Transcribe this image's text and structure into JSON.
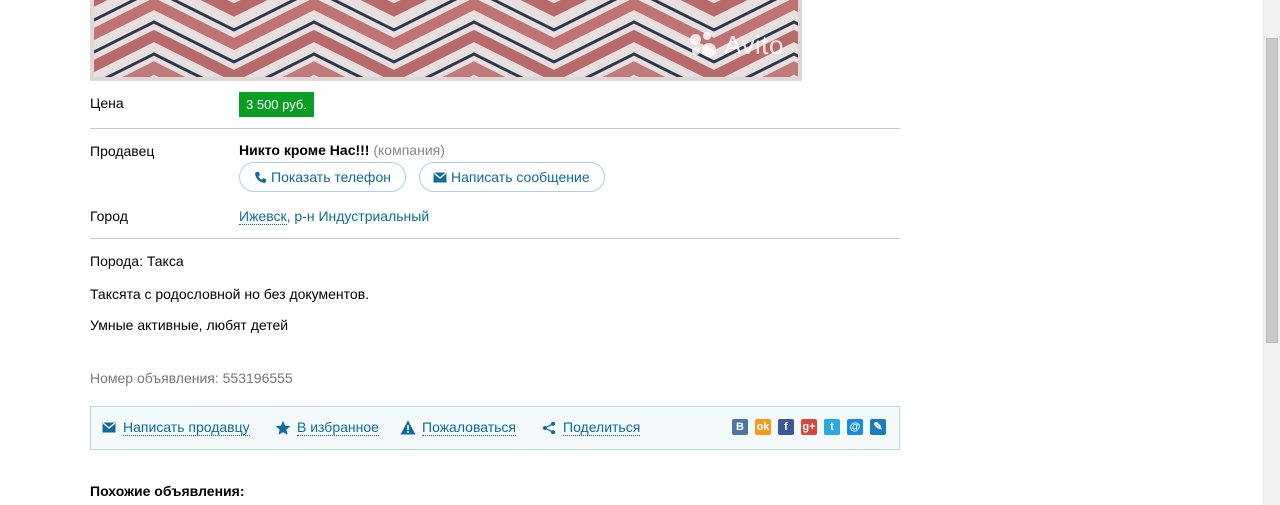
{
  "photo": {
    "watermark": "Avito"
  },
  "price": {
    "label": "Цена",
    "value": "3 500 руб."
  },
  "seller": {
    "label": "Продавец",
    "name": "Никто кроме Нас!!!",
    "type": "(компания)",
    "show_phone": "Показать телефон",
    "write_message": "Написать сообщение"
  },
  "city": {
    "label": "Город",
    "value_city": "Ижевск",
    "value_district": ", р-н Индустриальный"
  },
  "description": {
    "breed": "Порода: Такса",
    "line1": "Таксята с родословной но без документов.",
    "line2": "Умные активные, любят детей"
  },
  "ad_number": "Номер объявления: 553196555",
  "actions": {
    "write_seller": "Написать продавцу",
    "favorite": "В избранное",
    "report": "Пожаловаться",
    "share": "Поделиться"
  },
  "share_icons": [
    {
      "name": "vkontakte",
      "glyph": "В",
      "color": "#4c75a3"
    },
    {
      "name": "odnoklassniki",
      "glyph": "ok",
      "color": "#f59a1f"
    },
    {
      "name": "facebook",
      "glyph": "f",
      "color": "#3b5998"
    },
    {
      "name": "google-plus",
      "glyph": "g+",
      "color": "#d34836"
    },
    {
      "name": "twitter",
      "glyph": "t",
      "color": "#2aa9e0"
    },
    {
      "name": "mail-ru",
      "glyph": "@",
      "color": "#168de2"
    },
    {
      "name": "livejournal",
      "glyph": "✎",
      "color": "#1d7bbf"
    }
  ],
  "similar_heading": "Похожие объявления:"
}
